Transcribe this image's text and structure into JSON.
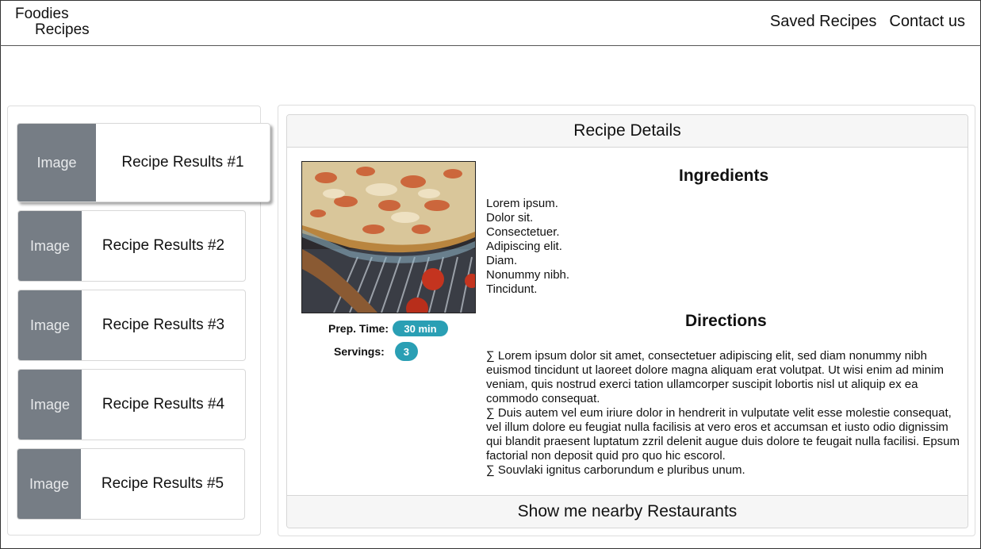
{
  "brand": {
    "line1": "Foodies",
    "line2": "Recipes"
  },
  "nav": {
    "saved_recipes": "Saved Recipes",
    "contact_us": "Contact us"
  },
  "results": [
    {
      "image": "Image",
      "label": "Recipe Results #1"
    },
    {
      "image": "Image",
      "label": "Recipe Results #2"
    },
    {
      "image": "Image",
      "label": "Recipe Results #3"
    },
    {
      "image": "Image",
      "label": "Recipe Results #4"
    },
    {
      "image": "Image",
      "label": "Recipe Results #5"
    }
  ],
  "details": {
    "header": "Recipe Details",
    "prep_time_label": "Prep. Time:",
    "prep_time_value": "30 min",
    "servings_label": "Servings:",
    "servings_value": "3",
    "ingredients_title": "Ingredients",
    "ingredients": [
      "Lorem ipsum.",
      "Dolor sit.",
      "Consectetuer.",
      "Adipiscing elit.",
      "Diam.",
      "Nonummy nibh.",
      "Tincidunt."
    ],
    "directions_title": "Directions",
    "directions": [
      "∑ Lorem ipsum dolor sit amet, consectetuer adipiscing elit, sed diam nonummy nibh euismod tincidunt ut laoreet dolore magna aliquam erat volutpat. Ut wisi enim ad minim veniam, quis nostrud exerci tation ullamcorper suscipit lobortis nisl ut aliquip ex ea commodo consequat.",
      "∑ Duis autem vel eum iriure dolor in hendrerit in vulputate velit esse molestie consequat, vel illum dolore eu feugiat nulla facilisis at vero eros et accumsan et iusto odio dignissim qui blandit praesent luptatum zzril delenit augue duis dolore te feugait nulla facilisi. Epsum factorial non deposit quid pro quo hic escorol.",
      "∑ Souvlaki ignitus carborundum e pluribus unum."
    ],
    "footer_button": "Show me nearby Restaurants"
  },
  "colors": {
    "thumb": "#767d85",
    "pill": "#2a9fb4",
    "header_bg": "#f6f6f6"
  }
}
